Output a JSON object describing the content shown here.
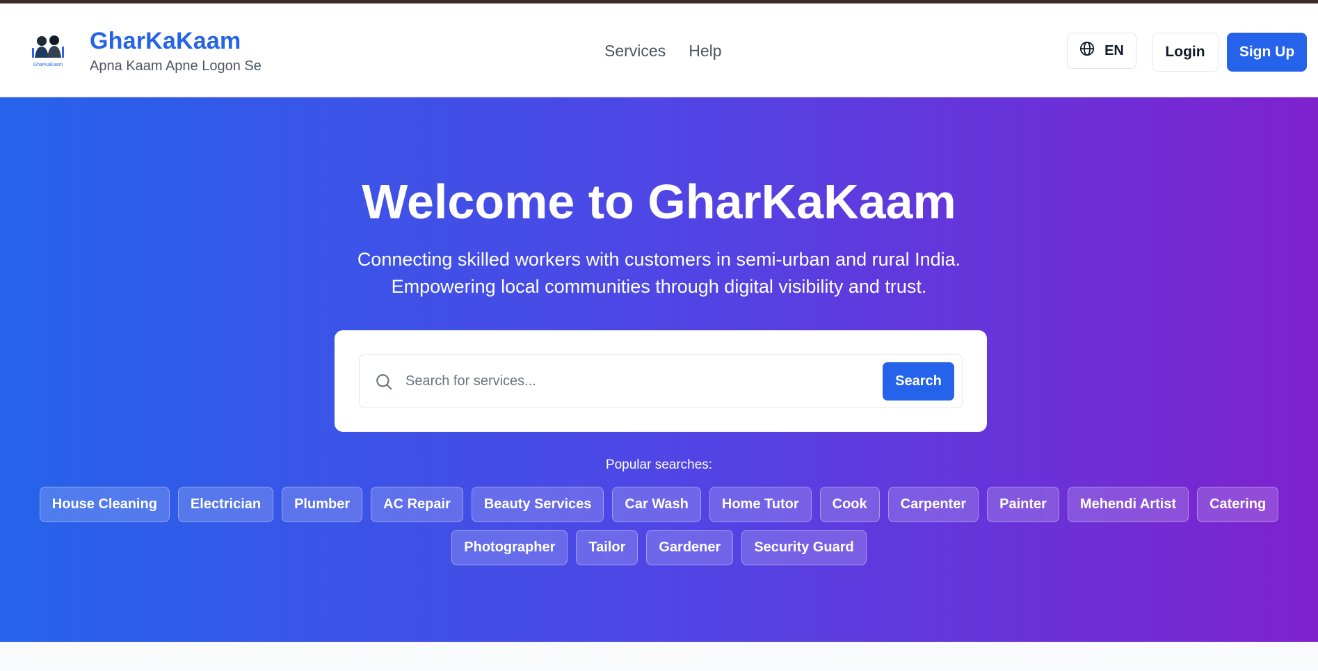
{
  "header": {
    "brand_title": "GharKaKaam",
    "brand_tagline": "Apna Kaam Apne Logon Se",
    "logo_text": "GharKaKaam",
    "nav": [
      {
        "label": "Services"
      },
      {
        "label": "Help"
      }
    ],
    "language": "EN",
    "login_label": "Login",
    "signup_label": "Sign Up"
  },
  "hero": {
    "title": "Welcome to GharKaKaam",
    "subtitle_line1": "Connecting skilled workers with customers in semi-urban and rural India.",
    "subtitle_line2": "Empowering local communities through digital visibility and trust.",
    "search": {
      "placeholder": "Search for services...",
      "value": "",
      "button_label": "Search"
    },
    "popular_label": "Popular searches:",
    "popular_tags": [
      "House Cleaning",
      "Electrician",
      "Plumber",
      "AC Repair",
      "Beauty Services",
      "Car Wash",
      "Home Tutor",
      "Cook",
      "Carpenter",
      "Painter",
      "Mehendi Artist",
      "Catering",
      "Photographer",
      "Tailor",
      "Gardener",
      "Security Guard"
    ]
  },
  "icons": {
    "language": "globe-icon",
    "search": "search-icon",
    "logo": "workers-logo-icon"
  },
  "colors": {
    "brand": "#2563eb",
    "gradient_start": "#2563eb",
    "gradient_mid": "#4f46e5",
    "gradient_end": "#7e22ce"
  }
}
